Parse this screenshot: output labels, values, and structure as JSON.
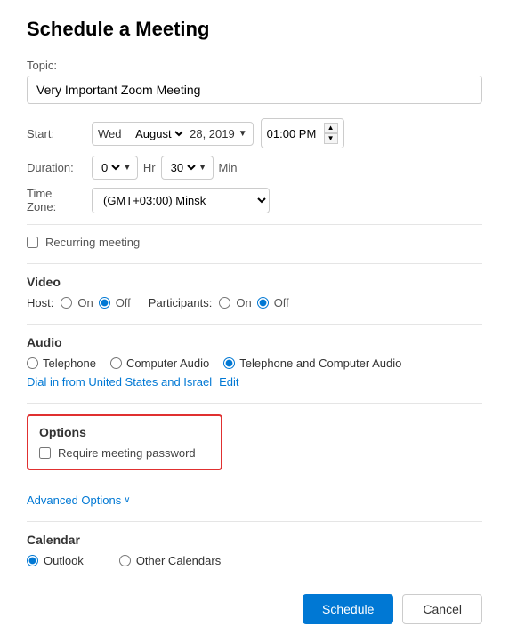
{
  "page": {
    "title": "Schedule a Meeting"
  },
  "topic": {
    "label": "Topic:",
    "value": "Very Important Zoom Meeting",
    "placeholder": "Very Important Zoom Meeting"
  },
  "start": {
    "label": "Start:",
    "day": "Wed",
    "month": "August",
    "date": "28, 2019",
    "time": "01:00 PM"
  },
  "duration": {
    "label": "Duration:",
    "hours_value": "0",
    "hr_label": "Hr",
    "minutes_value": "30",
    "min_label": "Min"
  },
  "timezone": {
    "label": "Time Zone:",
    "value": "(GMT+03:00) Minsk"
  },
  "recurring": {
    "label": "Recurring meeting"
  },
  "video": {
    "title": "Video",
    "host_label": "Host:",
    "host_on": "On",
    "host_off": "Off",
    "host_selected": "off",
    "participants_label": "Participants:",
    "participants_on": "On",
    "participants_off": "Off",
    "participants_selected": "off"
  },
  "audio": {
    "title": "Audio",
    "telephone": "Telephone",
    "computer": "Computer Audio",
    "both": "Telephone and Computer Audio",
    "selected": "both",
    "dial_in_text": "Dial in from United States and Israel",
    "edit_label": "Edit"
  },
  "options": {
    "title": "Options",
    "require_password_label": "Require meeting password",
    "require_password_checked": false
  },
  "advanced": {
    "label": "Advanced Options",
    "chevron": "∨"
  },
  "calendar": {
    "title": "Calendar",
    "outlook": "Outlook",
    "other": "Other Calendars",
    "selected": "outlook"
  },
  "buttons": {
    "schedule": "Schedule",
    "cancel": "Cancel"
  }
}
